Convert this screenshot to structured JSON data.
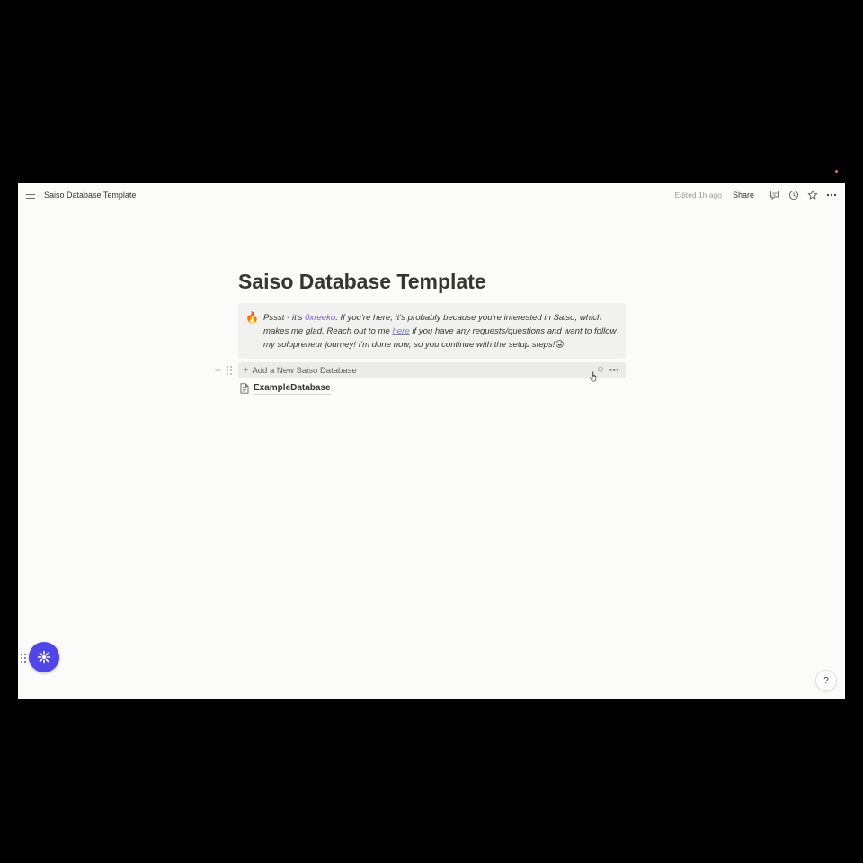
{
  "topbar": {
    "breadcrumb": "Saiso Database Template",
    "edited": "Edited 1h ago",
    "share_label": "Share",
    "icons": [
      "menu-icon",
      "comment-icon",
      "history-icon",
      "star-icon",
      "more-icon"
    ]
  },
  "page": {
    "title": "Saiso Database Template",
    "callout": {
      "emoji": "🔥",
      "text_1": "Pssst - it's ",
      "mention": "0xreeko",
      "text_2": ". If you're here, it's probably because you're interested in Saiso, which makes me glad. Reach out to me ",
      "link": "here",
      "text_3": " if you have any requests/questions and want to follow my solopreneur journey! I'm done now, so you continue with the setup steps!",
      "end_emoji": "😜"
    },
    "button_block": {
      "label": "Add a New Saiso Database"
    },
    "subpage": {
      "label": "ExampleDatabase"
    }
  },
  "help_label": "?",
  "colors": {
    "background": "#fbfbfa",
    "callout_bg": "#f1f1ef",
    "mention": "#7a5fcf",
    "fab": "#4f46e5"
  }
}
